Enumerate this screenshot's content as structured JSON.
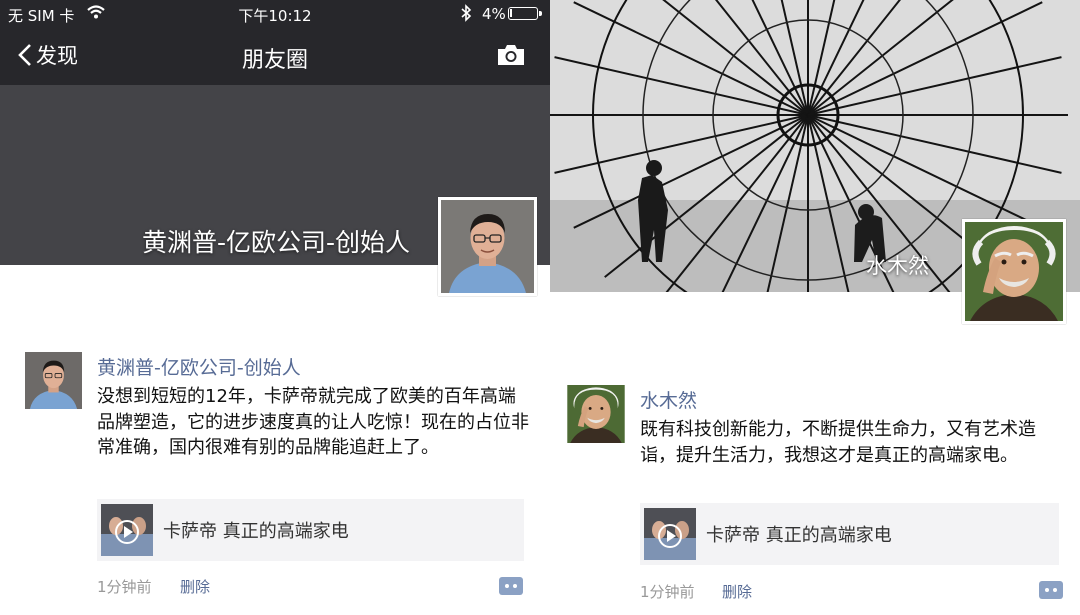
{
  "left": {
    "status_bar": {
      "carrier": "无 SIM 卡",
      "time": "下午10:12",
      "battery": "4%",
      "battery_level": 0.04
    },
    "nav": {
      "back_label": "发现",
      "title": "朋友圈",
      "camera_icon": "camera-icon"
    },
    "cover": {
      "name": "黄渊普-亿欧公司-创始人"
    },
    "post": {
      "author": "黄渊普-亿欧公司-创始人",
      "text": "没想到短短的12年，卡萨帝就完成了欧美的百年高端品牌塑造，它的进步速度真的让人吃惊！现在的占位非常准确，国内很难有别的品牌能追赶上了。",
      "link_title": "卡萨帝 真正的高端家电",
      "time": "1分钟前",
      "delete_label": "删除"
    }
  },
  "right": {
    "cover": {
      "name": "水木然"
    },
    "post": {
      "author": "水木然",
      "text": "既有科技创新能力，不断提供生命力，又有艺术造诣，提升生活力，我想这才是真正的高端家电。",
      "link_title": "卡萨帝 真正的高端家电",
      "time": "1分钟前",
      "delete_label": "删除"
    }
  },
  "colors": {
    "nav_bg": "#27272b",
    "link_name": "#576b95",
    "cover_left": "#444448"
  }
}
